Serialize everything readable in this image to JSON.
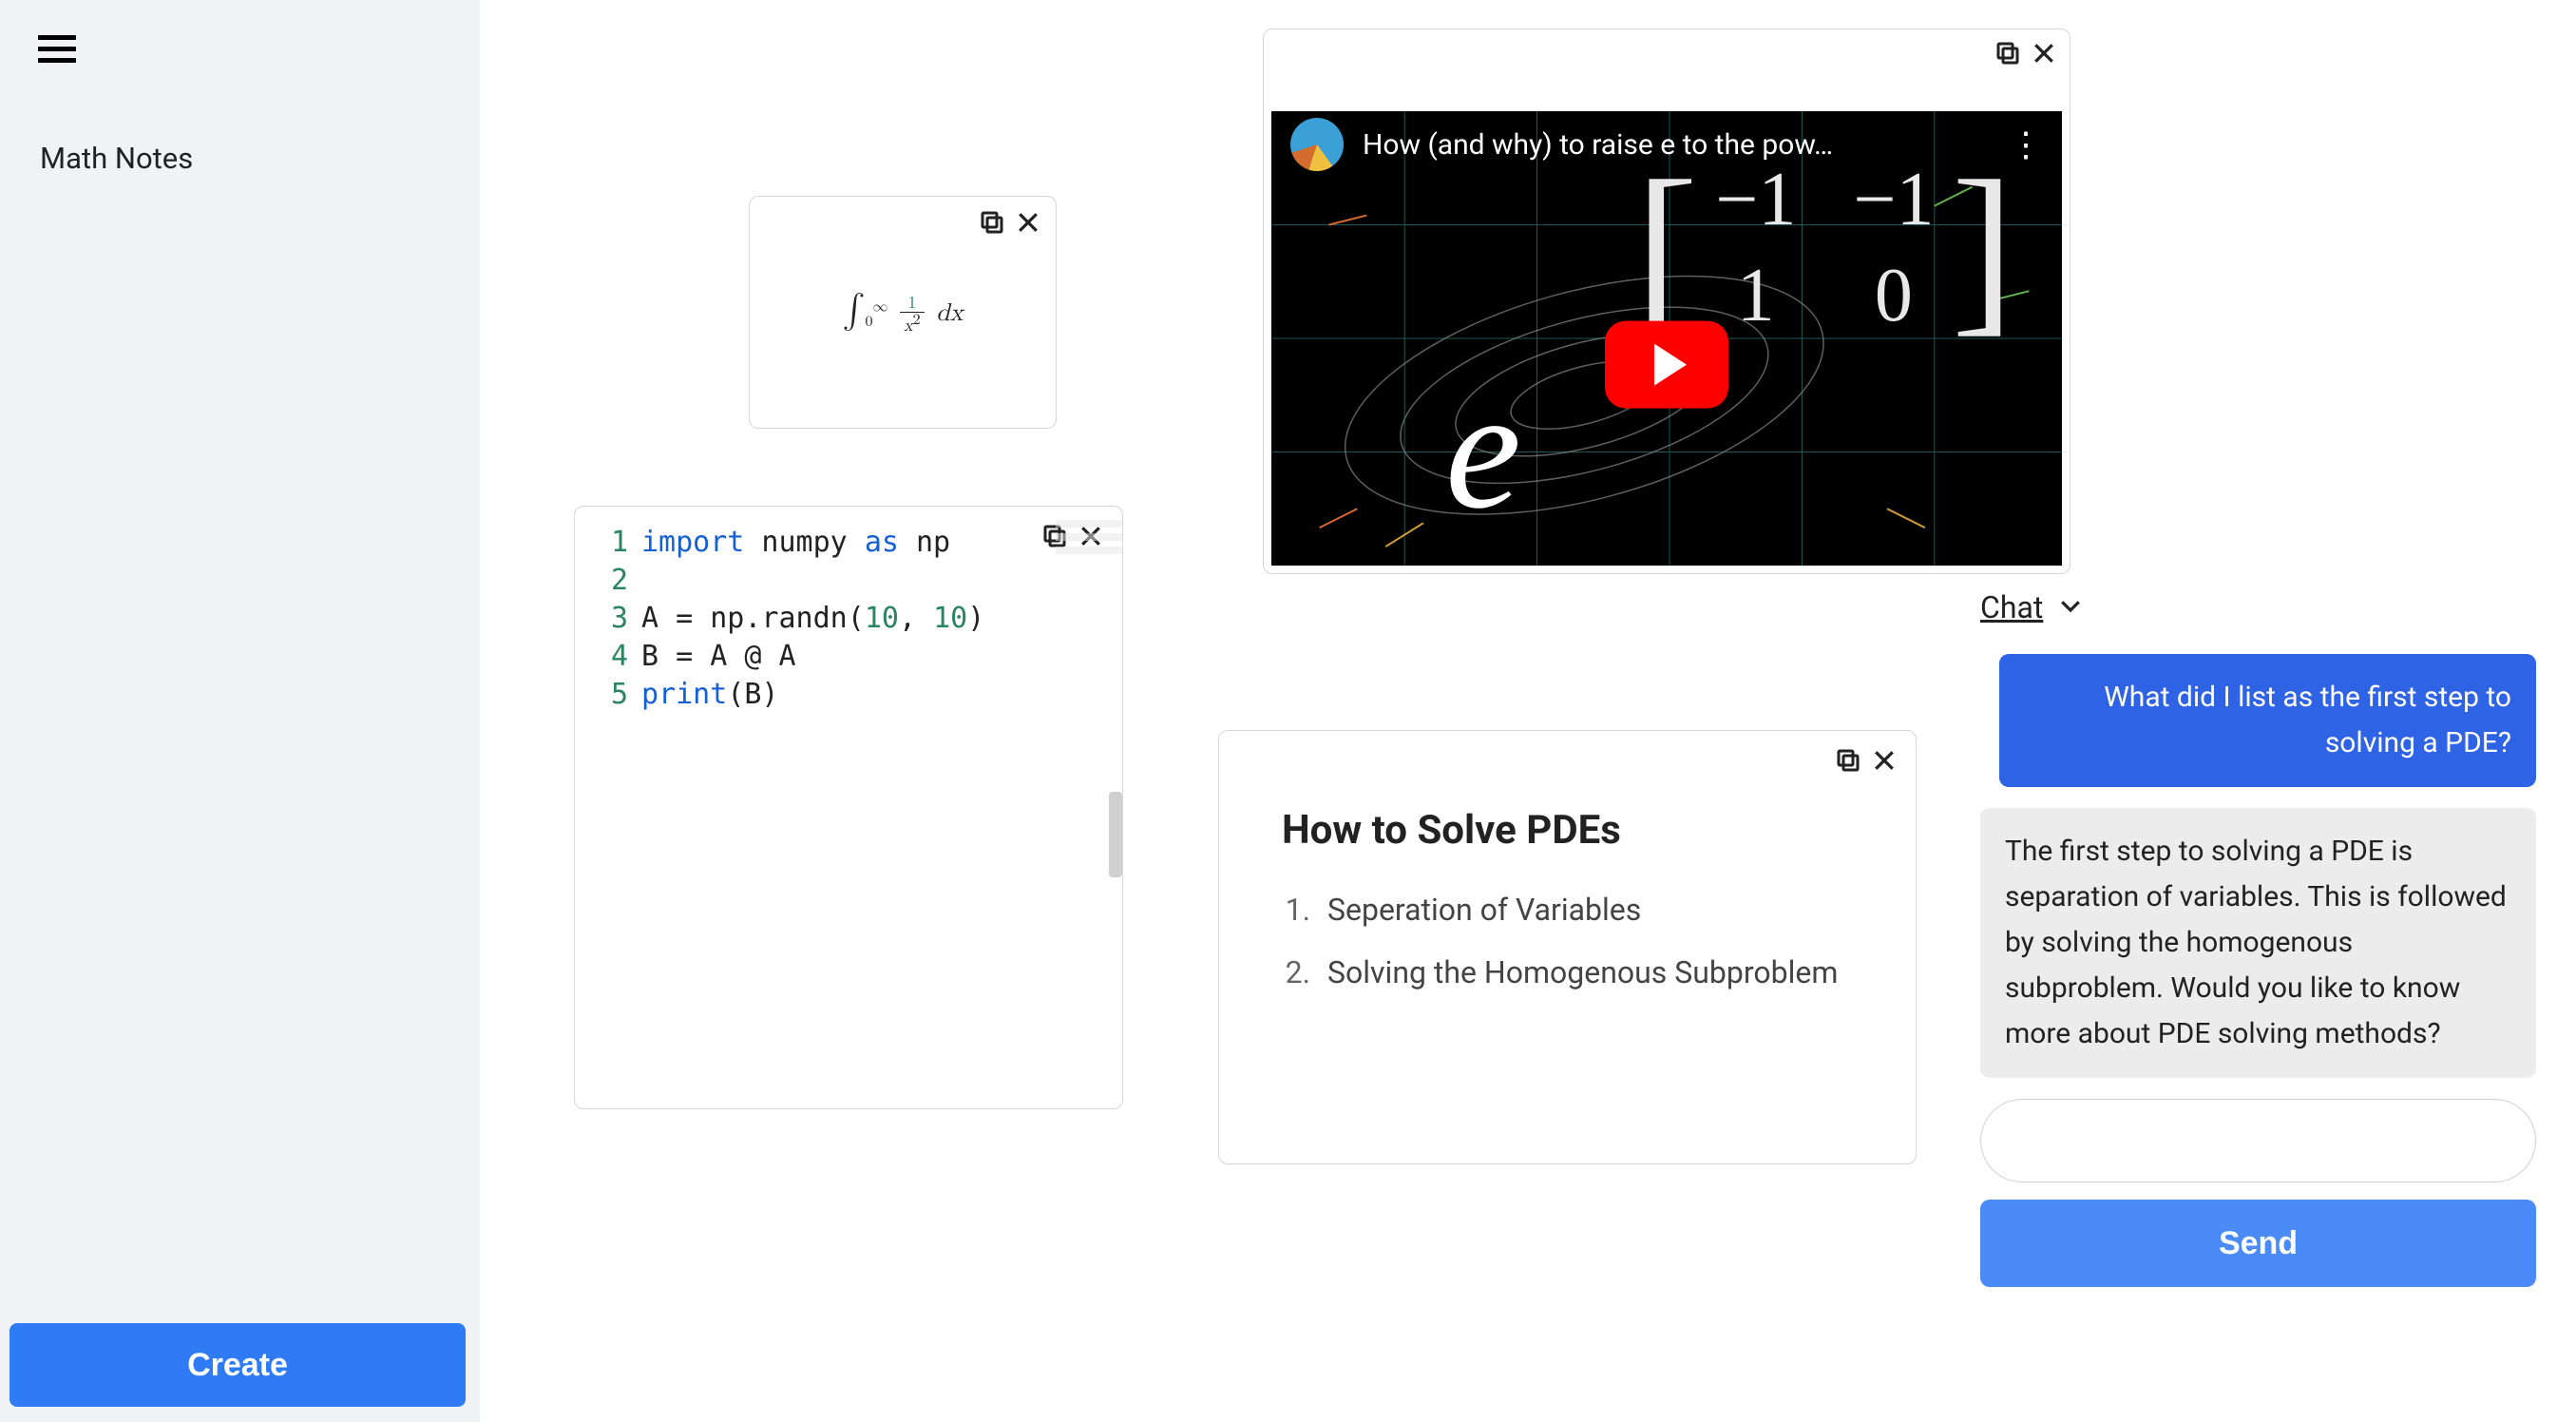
{
  "sidebar": {
    "title": "Math Notes",
    "create_label": "Create"
  },
  "formula": {
    "latex_display": "∫0∞ 1/x² dx"
  },
  "code": {
    "line_numbers": [
      "1",
      "2",
      "3",
      "4",
      "5"
    ],
    "lines": {
      "l1_kw": "import",
      "l1_rest": " numpy ",
      "l1_as": "as",
      "l1_np": " np",
      "l3_a": "A = np.randn(",
      "l3_n1": "10",
      "l3_c": ", ",
      "l3_n2": "10",
      "l3_close": ")",
      "l4": "B = A @ A",
      "l5_fn": "print",
      "l5_rest": "(B)"
    }
  },
  "video": {
    "title": "How (and why) to raise e to the pow…",
    "matrix": {
      "a": "−1",
      "b": "−1",
      "c": "1",
      "d": "0"
    },
    "e_glyph": "e"
  },
  "pde": {
    "heading": "How to Solve PDEs",
    "items": [
      {
        "n": "1.",
        "text": "Seperation of Variables"
      },
      {
        "n": "2.",
        "text": "Solving the Homogenous Subproblem"
      }
    ]
  },
  "chat": {
    "header": "Chat",
    "user_msg": "What did I list as the first step to solving a PDE?",
    "bot_msg": "The first step to solving a PDE is separation of variables. This is followed by solving the homogenous subproblem. Would you like to know more about PDE solving methods?",
    "input_value": "",
    "send_label": "Send"
  }
}
